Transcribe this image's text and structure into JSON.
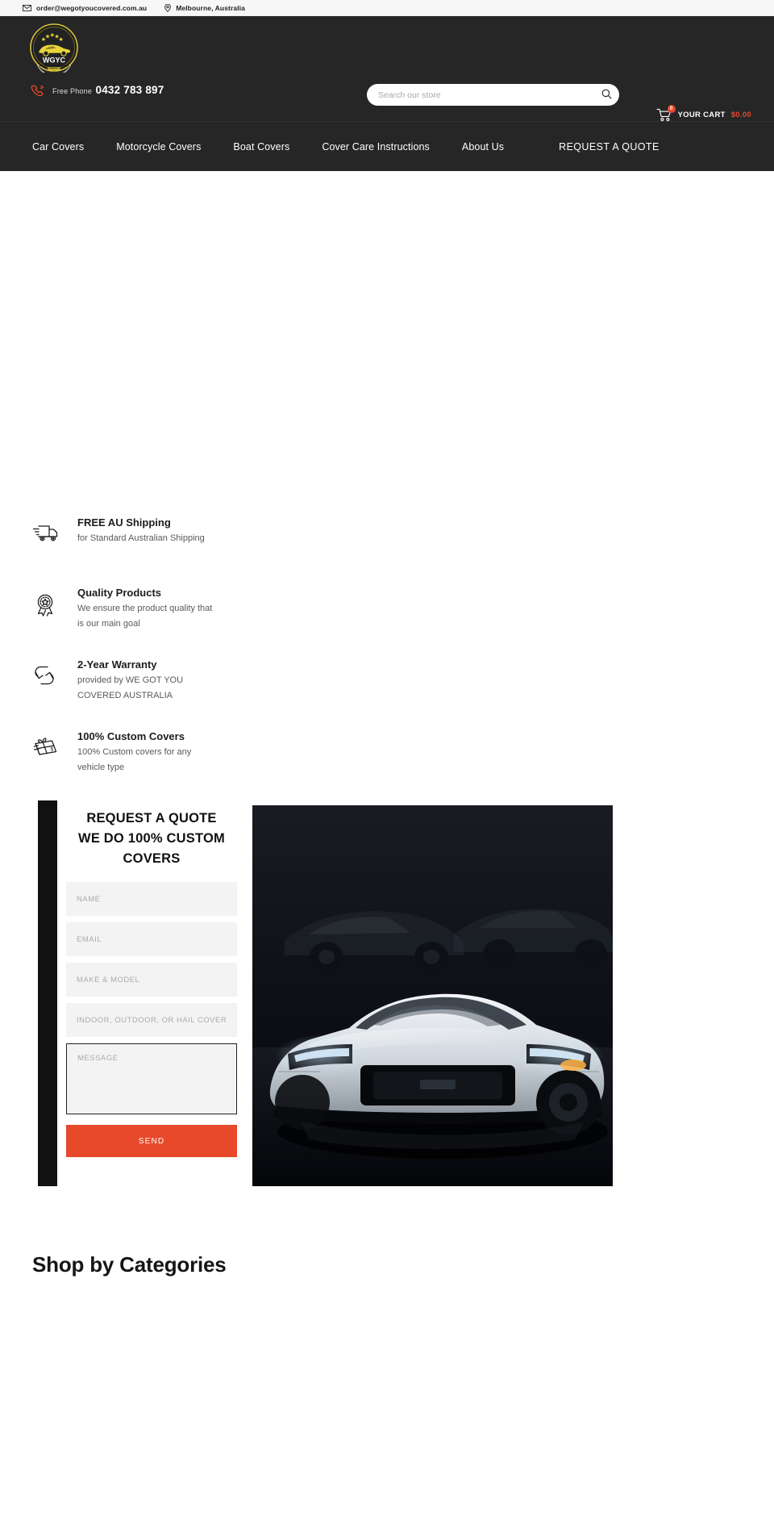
{
  "topbar": {
    "email": "order@wegotyoucovered.com.au",
    "location": "Melbourne, Australia",
    "email_icon": "envelope-icon",
    "location_icon": "map-pin-icon"
  },
  "header": {
    "logo_text": "WGYC",
    "logo_sub": "WE GOT YOU COVERED",
    "logo_country": "AUSTRALIA",
    "phone_label": "Free Phone",
    "phone_number": "0432 783 897",
    "search_placeholder": "Search our store",
    "cart_label": "YOUR CART",
    "cart_total": "$0.00",
    "cart_count": "0"
  },
  "nav": {
    "items": [
      {
        "label": "Car Covers"
      },
      {
        "label": "Motorcycle Covers"
      },
      {
        "label": "Boat Covers"
      },
      {
        "label": "Cover Care Instructions"
      },
      {
        "label": "About Us"
      }
    ],
    "cta": "REQUEST A QUOTE"
  },
  "features": [
    {
      "icon": "delivery-truck-icon",
      "title": "FREE AU Shipping",
      "desc": "for Standard Australian Shipping"
    },
    {
      "icon": "award-ribbon-icon",
      "title": "Quality Products",
      "desc": "We ensure the product quality that is our main goal"
    },
    {
      "icon": "exchange-arrows-icon",
      "title": "2-Year Warranty",
      "desc": "provided by WE GOT YOU COVERED AUSTRALIA"
    },
    {
      "icon": "gift-box-icon",
      "title": "100% Custom Covers",
      "desc": "100% Custom covers for any vehicle type"
    }
  ],
  "quote": {
    "heading_line1": "REQUEST A QUOTE",
    "heading_line2": "WE DO 100% CUSTOM",
    "heading_line3": "COVERS",
    "fields": [
      {
        "name": "name",
        "placeholder": "NAME",
        "value": ""
      },
      {
        "name": "email",
        "placeholder": "EMAIL",
        "value": ""
      },
      {
        "name": "make-model",
        "placeholder": "MAKE & MODEL",
        "value": ""
      },
      {
        "name": "cover-type",
        "placeholder": "INDOOR, OUTDOOR, OR HAIL COVER",
        "value": ""
      }
    ],
    "message_placeholder": "MESSAGE",
    "message_value": "",
    "send_label": "SEND",
    "photo_alt": "white-sports-car-in-dark-garage"
  },
  "shop": {
    "title": "Shop by Categories"
  },
  "colors": {
    "header_bg": "#262626",
    "accent": "#e8492a",
    "topbar_bg": "#f7f7f7",
    "field_bg": "#f3f3f3"
  }
}
